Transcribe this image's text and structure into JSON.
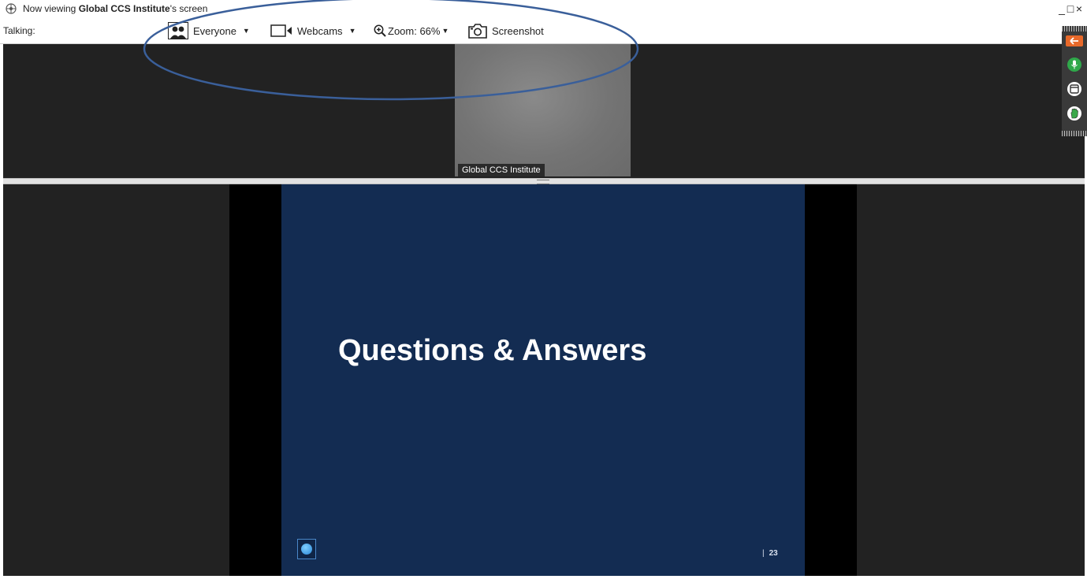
{
  "titlebar": {
    "prefix": "Now viewing ",
    "presenter": "Global CCS Institute",
    "suffix": "'s screen",
    "window_controls": [
      "_",
      "□",
      "×"
    ]
  },
  "toolbar": {
    "talking_label": "Talking:",
    "everyone_label": "Everyone",
    "webcams_label": "Webcams",
    "zoom_label": "Zoom: 66%",
    "screenshot_label": "Screenshot"
  },
  "webcam": {
    "tile_label": "Global CCS Institute"
  },
  "slide": {
    "title": "Questions & Answers",
    "page_sep": "|",
    "page_number": "23"
  },
  "colors": {
    "slide_bg": "#132c52",
    "share_bg": "#222222",
    "annotation": "#3a5f9a",
    "mic": "#2fa84a",
    "back": "#e8692a"
  },
  "icons": [
    "app-icon",
    "everyone-icon",
    "webcam-icon",
    "zoom-icon",
    "camera-icon",
    "back-arrow-icon",
    "microphone-icon",
    "window-icon",
    "raise-hand-icon"
  ]
}
